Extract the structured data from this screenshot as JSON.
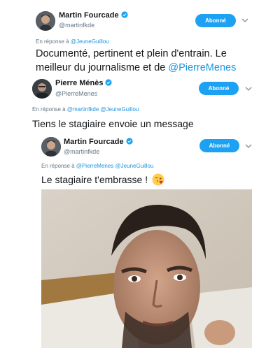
{
  "tweets": [
    {
      "name": "Martin Fourcade",
      "handle": "@martinfkde",
      "follow_label": "Abonné",
      "reply_prefix": "En réponse à",
      "reply_to": "@JeuneGuillou",
      "text_main": "Documenté, pertinent et plein d'entrain. Le",
      "text_line2": "meilleur du journalisme et de",
      "text_mention": "@PierreMenes"
    },
    {
      "name": "Pierre Ménès",
      "handle": "@PierreMenes",
      "follow_label": "Abonné",
      "reply_prefix": "En réponse à",
      "reply_to_1": "@martinfkde",
      "reply_to_2": "@JeuneGuillou",
      "text_main": "Tiens le stagiaire envoie un message"
    },
    {
      "name": "Martin Fourcade",
      "handle": "@martinfkde",
      "follow_label": "Abonné",
      "reply_prefix": "En réponse à",
      "reply_to_1": "@PierreMenes",
      "reply_to_2": "@JeuneGuillou",
      "text_main": "Le stagiaire t'embrasse !",
      "emoji": "face-blowing-kiss-emoji"
    }
  ],
  "colors": {
    "accent": "#1da1f2",
    "link": "#1b95e0",
    "muted": "#657786",
    "text": "#14171a"
  },
  "icons": [
    "verified-badge-icon",
    "chevron-down-icon"
  ]
}
